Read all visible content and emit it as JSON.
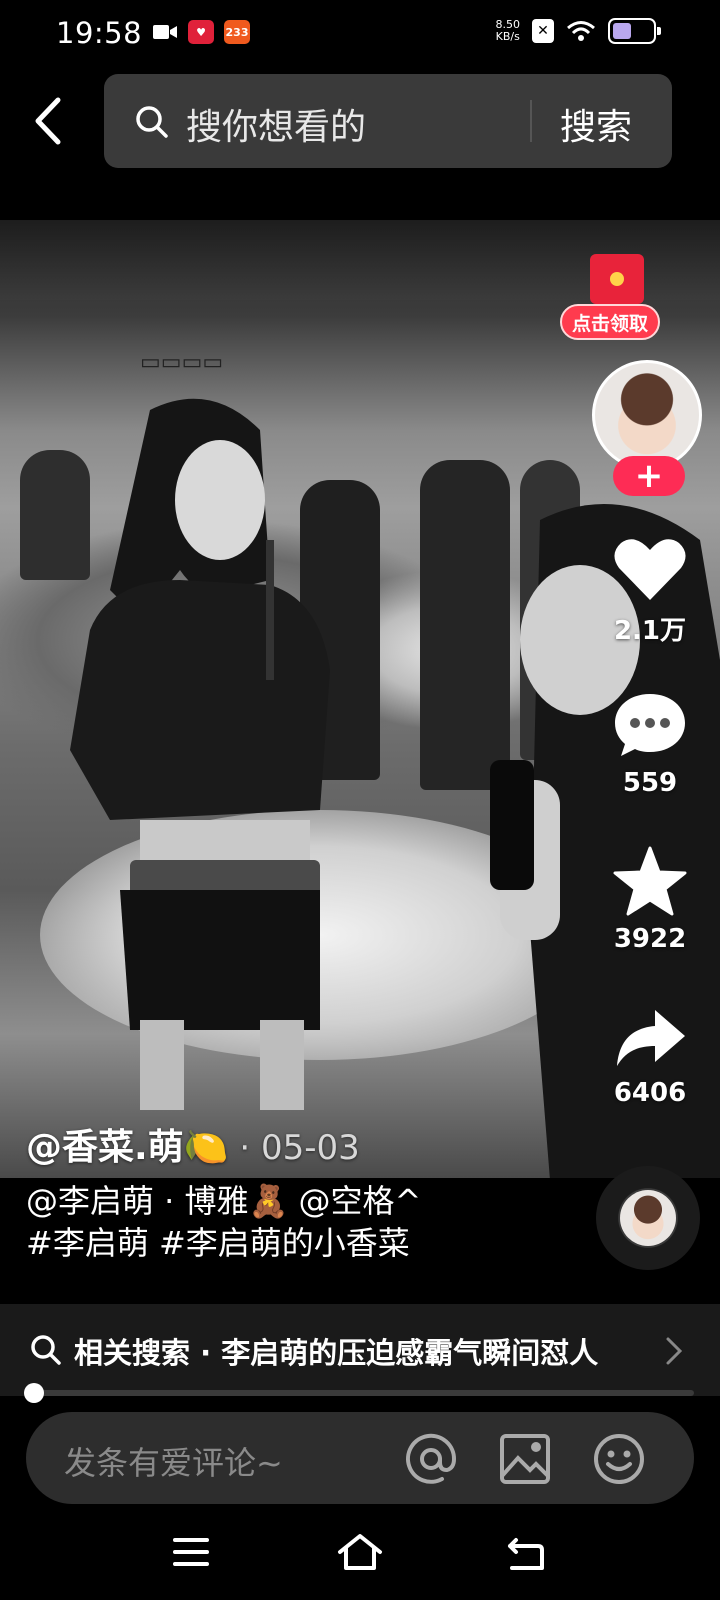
{
  "status_bar": {
    "time": "19:58",
    "badge_red": "♥",
    "badge_orange": "233",
    "net_speed_value": "8.50",
    "net_speed_unit": "KB/s",
    "battery_level": 0.4,
    "battery_color": "#b9a7ee"
  },
  "search": {
    "placeholder": "搜你想看的",
    "button": "搜索"
  },
  "video": {
    "author": "@香菜.萌🍋",
    "date": " · 05-03",
    "caption_line1": "@李启萌 · 博雅🧸 @空格^",
    "caption_line2": "#李启萌 #李启萌的小香菜",
    "progress": 0.01
  },
  "right_rail": {
    "red_packet_label": "点击领取",
    "follow_symbol": "+",
    "likes": "2.1万",
    "comments": "559",
    "favorites": "3922",
    "shares": "6406"
  },
  "related": {
    "text": "相关搜索 · 李启萌的压迫感霸气瞬间怼人"
  },
  "comment_bar": {
    "placeholder": "发条有爱评论~"
  },
  "colors": {
    "accent": "#fe2c55",
    "red_packet": "#ff3b4e",
    "search_bg": "#3a3a3a"
  },
  "icons": [
    "back-arrow-icon",
    "search-icon",
    "heart-icon",
    "comment-icon",
    "star-icon",
    "share-icon",
    "music-disc-icon",
    "chevron-right-icon",
    "at-icon",
    "image-icon",
    "emoji-icon",
    "menu-icon",
    "home-icon",
    "return-icon"
  ]
}
